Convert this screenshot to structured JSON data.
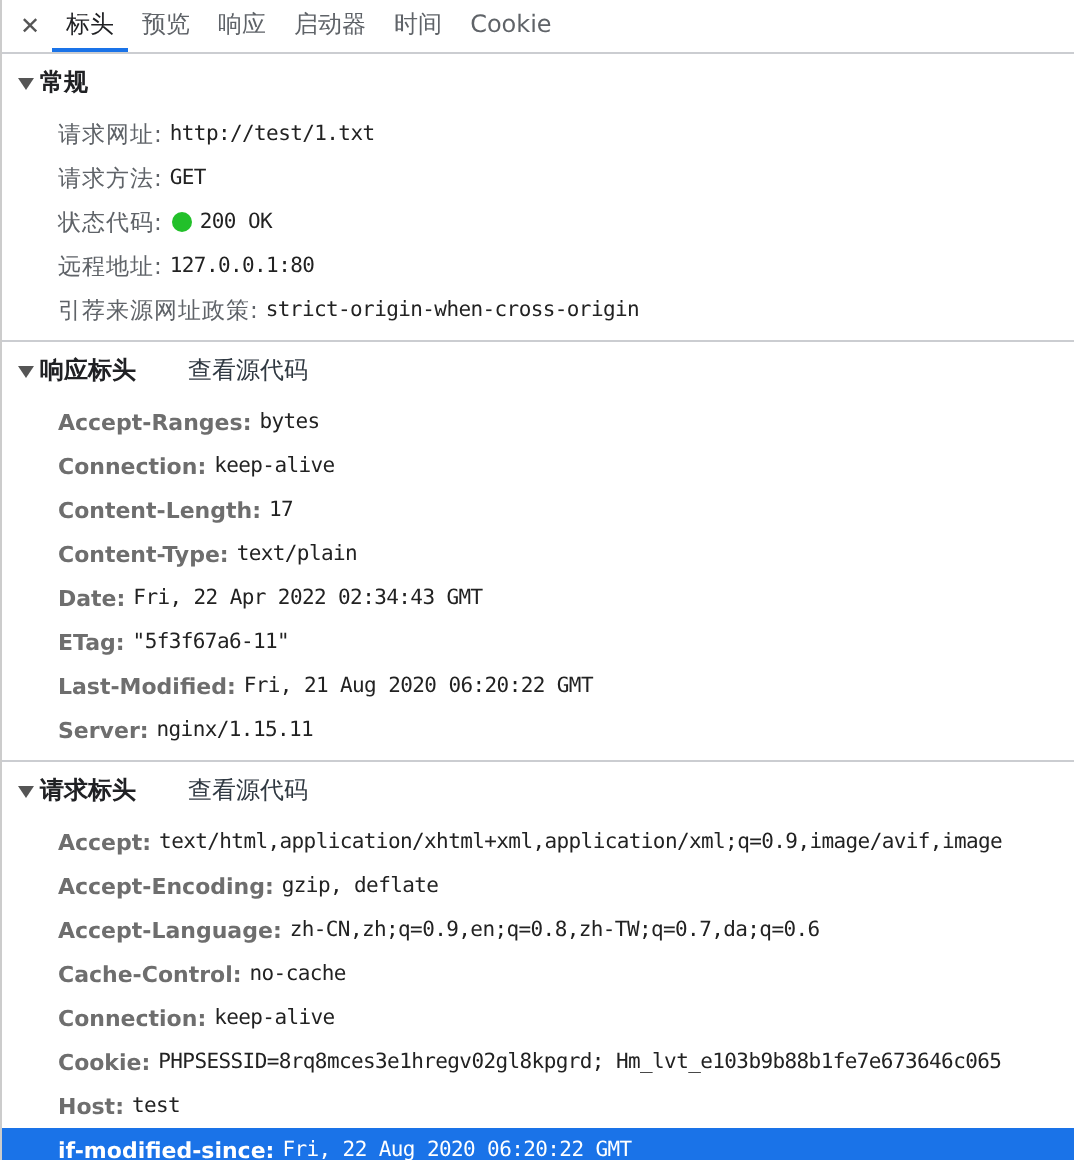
{
  "close_label": "✕",
  "tabs": [
    {
      "label": "标头",
      "selected": true
    },
    {
      "label": "预览",
      "selected": false
    },
    {
      "label": "响应",
      "selected": false
    },
    {
      "label": "启动器",
      "selected": false
    },
    {
      "label": "时间",
      "selected": false
    },
    {
      "label": "Cookie",
      "selected": false
    }
  ],
  "sections": [
    {
      "title": "常规",
      "expanded": true,
      "rows": [
        {
          "kind": "plain",
          "name": "请求网址:",
          "value": "http://test/1.txt"
        },
        {
          "kind": "plain",
          "name": "请求方法:",
          "value": "GET"
        },
        {
          "kind": "status",
          "name": "状态代码:",
          "value": "200 OK",
          "color": "#22c02a"
        },
        {
          "kind": "plain",
          "name": "远程地址:",
          "value": "127.0.0.1:80"
        },
        {
          "kind": "plain",
          "name": "引荐来源网址政策:",
          "value": "strict-origin-when-cross-origin"
        }
      ]
    },
    {
      "title": "响应标头",
      "link": "查看源代码",
      "expanded": true,
      "rows": [
        {
          "kind": "header",
          "name": "Accept-Ranges:",
          "value": "bytes",
          "selected": false
        },
        {
          "kind": "header",
          "name": "Connection:",
          "value": "keep-alive",
          "selected": false
        },
        {
          "kind": "header",
          "name": "Content-Length:",
          "value": "17",
          "selected": false
        },
        {
          "kind": "header",
          "name": "Content-Type:",
          "value": "text/plain",
          "selected": false
        },
        {
          "kind": "header",
          "name": "Date:",
          "value": "Fri, 22 Apr 2022 02:34:43 GMT",
          "selected": false
        },
        {
          "kind": "header",
          "name": "ETag:",
          "value": "\"5f3f67a6-11\"",
          "selected": false
        },
        {
          "kind": "header",
          "name": "Last-Modified:",
          "value": "Fri, 21 Aug 2020 06:20:22 GMT",
          "selected": false
        },
        {
          "kind": "header",
          "name": "Server:",
          "value": "nginx/1.15.11",
          "selected": false
        }
      ]
    },
    {
      "title": "请求标头",
      "link": "查看源代码",
      "expanded": true,
      "rows": [
        {
          "kind": "header",
          "name": "Accept:",
          "value": "text/html,application/xhtml+xml,application/xml;q=0.9,image/avif,image",
          "selected": false
        },
        {
          "kind": "header",
          "name": "Accept-Encoding:",
          "value": "gzip, deflate",
          "selected": false
        },
        {
          "kind": "header",
          "name": "Accept-Language:",
          "value": "zh-CN,zh;q=0.9,en;q=0.8,zh-TW;q=0.7,da;q=0.6",
          "selected": false
        },
        {
          "kind": "header",
          "name": "Cache-Control:",
          "value": "no-cache",
          "selected": false
        },
        {
          "kind": "header",
          "name": "Connection:",
          "value": "keep-alive",
          "selected": false
        },
        {
          "kind": "header",
          "name": "Cookie:",
          "value": "PHPSESSID=8rq8mces3e1hregv02gl8kpgrd; Hm_lvt_e103b9b88b1fe7e673646c065",
          "selected": false
        },
        {
          "kind": "header",
          "name": "Host:",
          "value": "test",
          "selected": false
        },
        {
          "kind": "header",
          "name": "if-modified-since:",
          "value": "Fri, 22 Aug 2020 06:20:22 GMT",
          "selected": true
        }
      ]
    }
  ]
}
